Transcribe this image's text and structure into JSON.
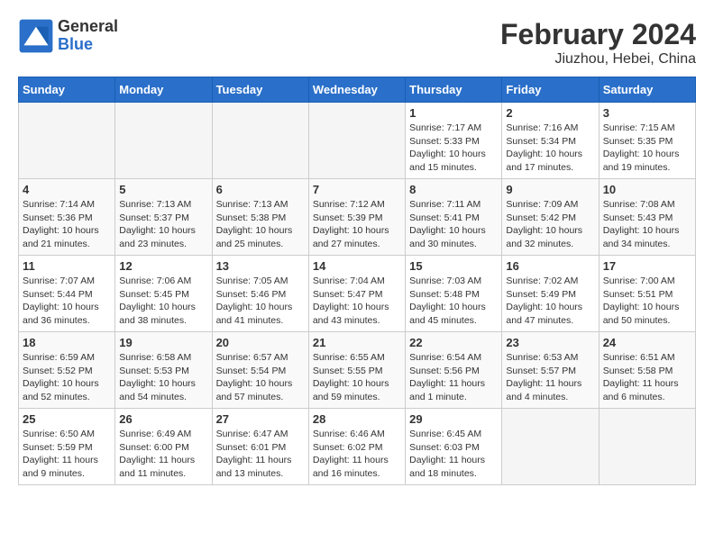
{
  "logo": {
    "general": "General",
    "blue": "Blue"
  },
  "title": "February 2024",
  "subtitle": "Jiuzhou, Hebei, China",
  "days_of_week": [
    "Sunday",
    "Monday",
    "Tuesday",
    "Wednesday",
    "Thursday",
    "Friday",
    "Saturday"
  ],
  "weeks": [
    [
      {
        "day": "",
        "empty": true
      },
      {
        "day": "",
        "empty": true
      },
      {
        "day": "",
        "empty": true
      },
      {
        "day": "",
        "empty": true
      },
      {
        "day": "1",
        "sunrise": "Sunrise: 7:17 AM",
        "sunset": "Sunset: 5:33 PM",
        "daylight": "Daylight: 10 hours and 15 minutes."
      },
      {
        "day": "2",
        "sunrise": "Sunrise: 7:16 AM",
        "sunset": "Sunset: 5:34 PM",
        "daylight": "Daylight: 10 hours and 17 minutes."
      },
      {
        "day": "3",
        "sunrise": "Sunrise: 7:15 AM",
        "sunset": "Sunset: 5:35 PM",
        "daylight": "Daylight: 10 hours and 19 minutes."
      }
    ],
    [
      {
        "day": "4",
        "sunrise": "Sunrise: 7:14 AM",
        "sunset": "Sunset: 5:36 PM",
        "daylight": "Daylight: 10 hours and 21 minutes."
      },
      {
        "day": "5",
        "sunrise": "Sunrise: 7:13 AM",
        "sunset": "Sunset: 5:37 PM",
        "daylight": "Daylight: 10 hours and 23 minutes."
      },
      {
        "day": "6",
        "sunrise": "Sunrise: 7:13 AM",
        "sunset": "Sunset: 5:38 PM",
        "daylight": "Daylight: 10 hours and 25 minutes."
      },
      {
        "day": "7",
        "sunrise": "Sunrise: 7:12 AM",
        "sunset": "Sunset: 5:39 PM",
        "daylight": "Daylight: 10 hours and 27 minutes."
      },
      {
        "day": "8",
        "sunrise": "Sunrise: 7:11 AM",
        "sunset": "Sunset: 5:41 PM",
        "daylight": "Daylight: 10 hours and 30 minutes."
      },
      {
        "day": "9",
        "sunrise": "Sunrise: 7:09 AM",
        "sunset": "Sunset: 5:42 PM",
        "daylight": "Daylight: 10 hours and 32 minutes."
      },
      {
        "day": "10",
        "sunrise": "Sunrise: 7:08 AM",
        "sunset": "Sunset: 5:43 PM",
        "daylight": "Daylight: 10 hours and 34 minutes."
      }
    ],
    [
      {
        "day": "11",
        "sunrise": "Sunrise: 7:07 AM",
        "sunset": "Sunset: 5:44 PM",
        "daylight": "Daylight: 10 hours and 36 minutes."
      },
      {
        "day": "12",
        "sunrise": "Sunrise: 7:06 AM",
        "sunset": "Sunset: 5:45 PM",
        "daylight": "Daylight: 10 hours and 38 minutes."
      },
      {
        "day": "13",
        "sunrise": "Sunrise: 7:05 AM",
        "sunset": "Sunset: 5:46 PM",
        "daylight": "Daylight: 10 hours and 41 minutes."
      },
      {
        "day": "14",
        "sunrise": "Sunrise: 7:04 AM",
        "sunset": "Sunset: 5:47 PM",
        "daylight": "Daylight: 10 hours and 43 minutes."
      },
      {
        "day": "15",
        "sunrise": "Sunrise: 7:03 AM",
        "sunset": "Sunset: 5:48 PM",
        "daylight": "Daylight: 10 hours and 45 minutes."
      },
      {
        "day": "16",
        "sunrise": "Sunrise: 7:02 AM",
        "sunset": "Sunset: 5:49 PM",
        "daylight": "Daylight: 10 hours and 47 minutes."
      },
      {
        "day": "17",
        "sunrise": "Sunrise: 7:00 AM",
        "sunset": "Sunset: 5:51 PM",
        "daylight": "Daylight: 10 hours and 50 minutes."
      }
    ],
    [
      {
        "day": "18",
        "sunrise": "Sunrise: 6:59 AM",
        "sunset": "Sunset: 5:52 PM",
        "daylight": "Daylight: 10 hours and 52 minutes."
      },
      {
        "day": "19",
        "sunrise": "Sunrise: 6:58 AM",
        "sunset": "Sunset: 5:53 PM",
        "daylight": "Daylight: 10 hours and 54 minutes."
      },
      {
        "day": "20",
        "sunrise": "Sunrise: 6:57 AM",
        "sunset": "Sunset: 5:54 PM",
        "daylight": "Daylight: 10 hours and 57 minutes."
      },
      {
        "day": "21",
        "sunrise": "Sunrise: 6:55 AM",
        "sunset": "Sunset: 5:55 PM",
        "daylight": "Daylight: 10 hours and 59 minutes."
      },
      {
        "day": "22",
        "sunrise": "Sunrise: 6:54 AM",
        "sunset": "Sunset: 5:56 PM",
        "daylight": "Daylight: 11 hours and 1 minute."
      },
      {
        "day": "23",
        "sunrise": "Sunrise: 6:53 AM",
        "sunset": "Sunset: 5:57 PM",
        "daylight": "Daylight: 11 hours and 4 minutes."
      },
      {
        "day": "24",
        "sunrise": "Sunrise: 6:51 AM",
        "sunset": "Sunset: 5:58 PM",
        "daylight": "Daylight: 11 hours and 6 minutes."
      }
    ],
    [
      {
        "day": "25",
        "sunrise": "Sunrise: 6:50 AM",
        "sunset": "Sunset: 5:59 PM",
        "daylight": "Daylight: 11 hours and 9 minutes."
      },
      {
        "day": "26",
        "sunrise": "Sunrise: 6:49 AM",
        "sunset": "Sunset: 6:00 PM",
        "daylight": "Daylight: 11 hours and 11 minutes."
      },
      {
        "day": "27",
        "sunrise": "Sunrise: 6:47 AM",
        "sunset": "Sunset: 6:01 PM",
        "daylight": "Daylight: 11 hours and 13 minutes."
      },
      {
        "day": "28",
        "sunrise": "Sunrise: 6:46 AM",
        "sunset": "Sunset: 6:02 PM",
        "daylight": "Daylight: 11 hours and 16 minutes."
      },
      {
        "day": "29",
        "sunrise": "Sunrise: 6:45 AM",
        "sunset": "Sunset: 6:03 PM",
        "daylight": "Daylight: 11 hours and 18 minutes."
      },
      {
        "day": "",
        "empty": true
      },
      {
        "day": "",
        "empty": true
      }
    ]
  ]
}
